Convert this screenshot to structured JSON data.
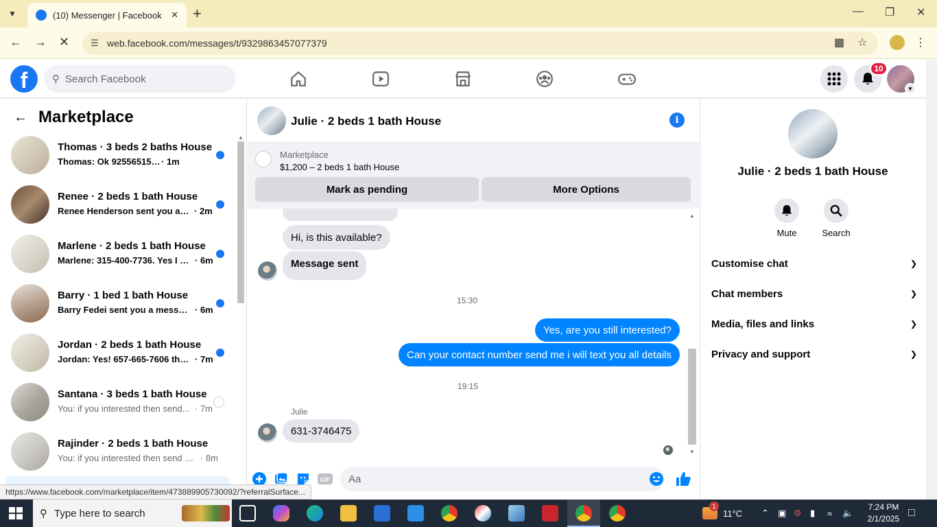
{
  "browser": {
    "tab_title": "(10) Messenger | Facebook",
    "url": "web.facebook.com/messages/t/9329863457077379",
    "status_url": "https://www.facebook.com/marketplace/item/473889905730092/?referralSurface..."
  },
  "fb": {
    "logo": "f",
    "search_placeholder": "Search Facebook",
    "notifications_count": "10",
    "nav_icons": [
      "home-icon",
      "video-icon",
      "marketplace-icon",
      "groups-icon",
      "gaming-icon"
    ],
    "brand_color": "#1877f2"
  },
  "left_panel": {
    "title": "Marketplace",
    "conversations": [
      {
        "name": "Thomas · 3 beds 2 baths House",
        "snippet": "Thomas: Ok 9255651586",
        "time": "· 1m",
        "unread": true
      },
      {
        "name": "Renee · 2 beds 1 bath House",
        "snippet": "Renee Henderson sent you a m...",
        "time": "· 2m",
        "unread": true
      },
      {
        "name": "Marlene · 2 beds 1 bath House",
        "snippet": "Marlene: 315-400-7736. Yes I a...",
        "time": "· 6m",
        "unread": true
      },
      {
        "name": "Barry · 1 bed 1 bath House",
        "snippet": "Barry Fedei sent you a messag...",
        "time": "· 6m",
        "unread": true
      },
      {
        "name": "Jordan · 2 beds 1 bath House",
        "snippet": "Jordan: Yes! 657-665-7606 tha...",
        "time": "· 7m",
        "unread": true
      },
      {
        "name": "Santana · 3 beds 1 bath House",
        "snippet": "You: if you interested then send...",
        "time": "· 7m",
        "unread": false
      },
      {
        "name": "Rajinder · 2 beds 1 bath House",
        "snippet": "You: if you interested then send m...",
        "time": "· 8m",
        "unread": false
      }
    ]
  },
  "chat": {
    "title": "Julie · 2 beds 1 bath House",
    "marketplace_label": "Marketplace",
    "listing": "$1,200 – 2 beds 1 bath House",
    "mark_pending": "Mark as pending",
    "more_options": "More Options",
    "messages": {
      "m1": "Hi, is this available?",
      "m2": "Message sent",
      "time1": "15:30",
      "m3": "Yes, are you still interested?",
      "m4": "Can your contact number send me i will text you all details",
      "time2": "19:15",
      "sender": "Julie",
      "m5": "631-3746475"
    },
    "composer_placeholder": "Aa",
    "accent_color": "#0084ff"
  },
  "info_panel": {
    "name": "Julie · 2 beds 1 bath House",
    "mute": "Mute",
    "search": "Search",
    "sections": [
      "Customise chat",
      "Chat members",
      "Media, files and links",
      "Privacy and support"
    ]
  },
  "taskbar": {
    "search_placeholder": "Type here to search",
    "temperature": "11°C",
    "weather_badge": "1",
    "time": "7:24 PM",
    "date": "2/1/2025"
  }
}
